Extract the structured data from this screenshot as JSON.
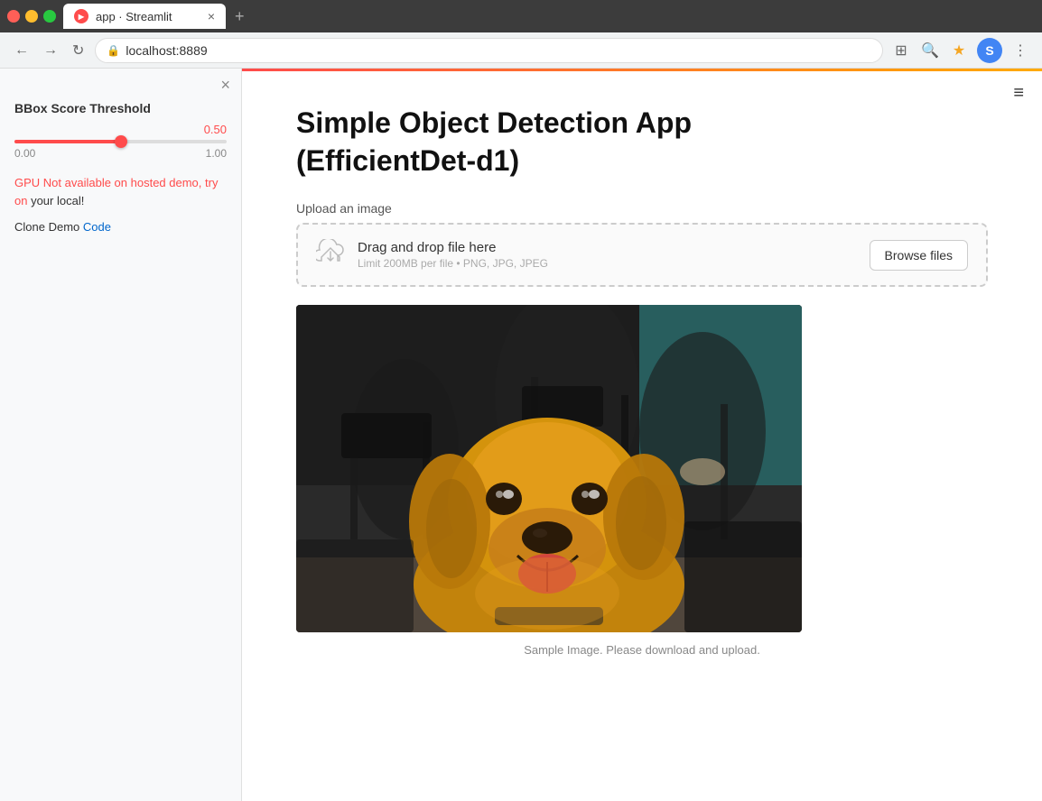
{
  "browser": {
    "tab_title": "app · Streamlit",
    "url": "localhost:8889",
    "new_tab_icon": "+",
    "profile_letter": "S"
  },
  "sidebar": {
    "close_icon": "×",
    "slider_label": "BBox Score Threshold",
    "slider_value": "0.50",
    "slider_min": "0.00",
    "slider_max": "1.00",
    "slider_pct": 50,
    "gpu_note": "GPU Not available on hosted demo, try on your local!",
    "clone_demo_prefix": "Clone Demo ",
    "clone_demo_link": "Code"
  },
  "main": {
    "hamburger": "≡",
    "page_title": "Simple Object Detection App\n(EfficientDet-d1)",
    "upload_label": "Upload an image",
    "drag_drop_text": "Drag and drop file here",
    "upload_limit": "Limit 200MB per file • PNG, JPG, JPEG",
    "browse_btn": "Browse files",
    "image_caption": "Sample Image. Please download and upload."
  }
}
